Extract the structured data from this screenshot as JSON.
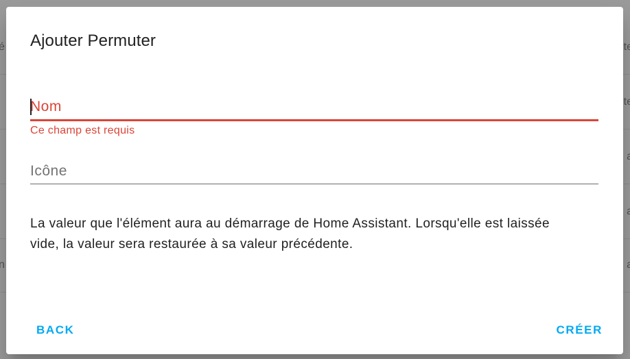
{
  "background": {
    "left_fragments": [
      "é",
      "",
      "",
      "n",
      ""
    ],
    "right_fragments": [
      "te",
      "te",
      "a",
      "a",
      "a"
    ]
  },
  "dialog": {
    "title": "Ajouter Permuter",
    "name_field": {
      "placeholder": "Nom",
      "value": "",
      "error": "Ce champ est requis"
    },
    "icon_field": {
      "placeholder": "Icône",
      "value": ""
    },
    "description": "La valeur que l'élément aura au démarrage de Home Assistant. Lorsqu'elle est laissée vide, la valeur sera restaurée à sa valeur précédente.",
    "actions": {
      "back_label": "BACK",
      "create_label": "CRÉER"
    }
  },
  "colors": {
    "error": "#db4437",
    "accent": "#03a9f4",
    "scrim": "#9a9a9a"
  }
}
